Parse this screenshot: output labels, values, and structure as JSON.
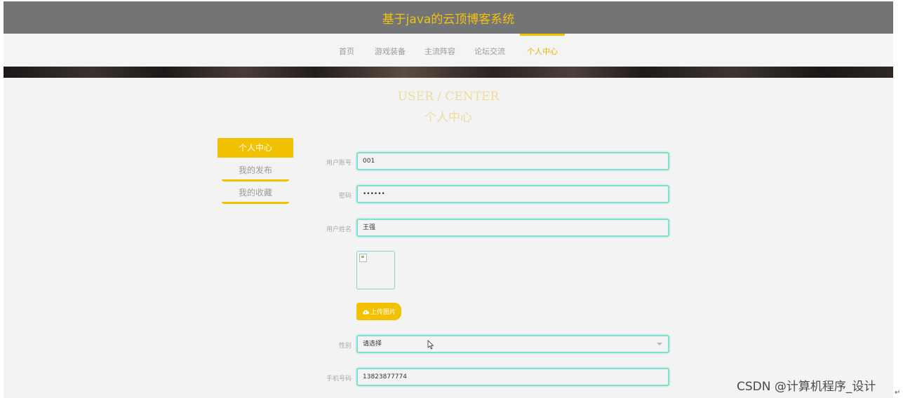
{
  "header": {
    "site_title": "基于java的云顶博客系统"
  },
  "nav": {
    "items": [
      {
        "label": "首页"
      },
      {
        "label": "游戏装备"
      },
      {
        "label": "主流阵容"
      },
      {
        "label": "论坛交流"
      },
      {
        "label": "个人中心"
      }
    ],
    "active_index": 4
  },
  "page_heading": {
    "en": "USER / CENTER",
    "cn": "个人中心"
  },
  "side_menu": {
    "items": [
      {
        "label": "个人中心"
      },
      {
        "label": "我的发布"
      },
      {
        "label": "我的收藏"
      }
    ],
    "active_index": 0
  },
  "form": {
    "username": {
      "label": "用户账号",
      "value": "001"
    },
    "password": {
      "label": "密码",
      "value": "••••••"
    },
    "realname": {
      "label": "用户姓名",
      "value": "王强"
    },
    "avatar": {
      "icon": "broken-image-icon"
    },
    "upload": {
      "label": "上传图片",
      "icon": "cloud-upload-icon"
    },
    "gender": {
      "label": "性别",
      "selected": "请选择"
    },
    "phone": {
      "label": "手机号码",
      "value": "13823877774"
    }
  },
  "colors": {
    "accent": "#f2c200",
    "title_bar": "#737476",
    "input_border": "#7fe0cf",
    "background": "#f3f3f3"
  },
  "watermark": {
    "text": "CSDN @计算机程序_设计",
    "return_mark": "↵"
  }
}
